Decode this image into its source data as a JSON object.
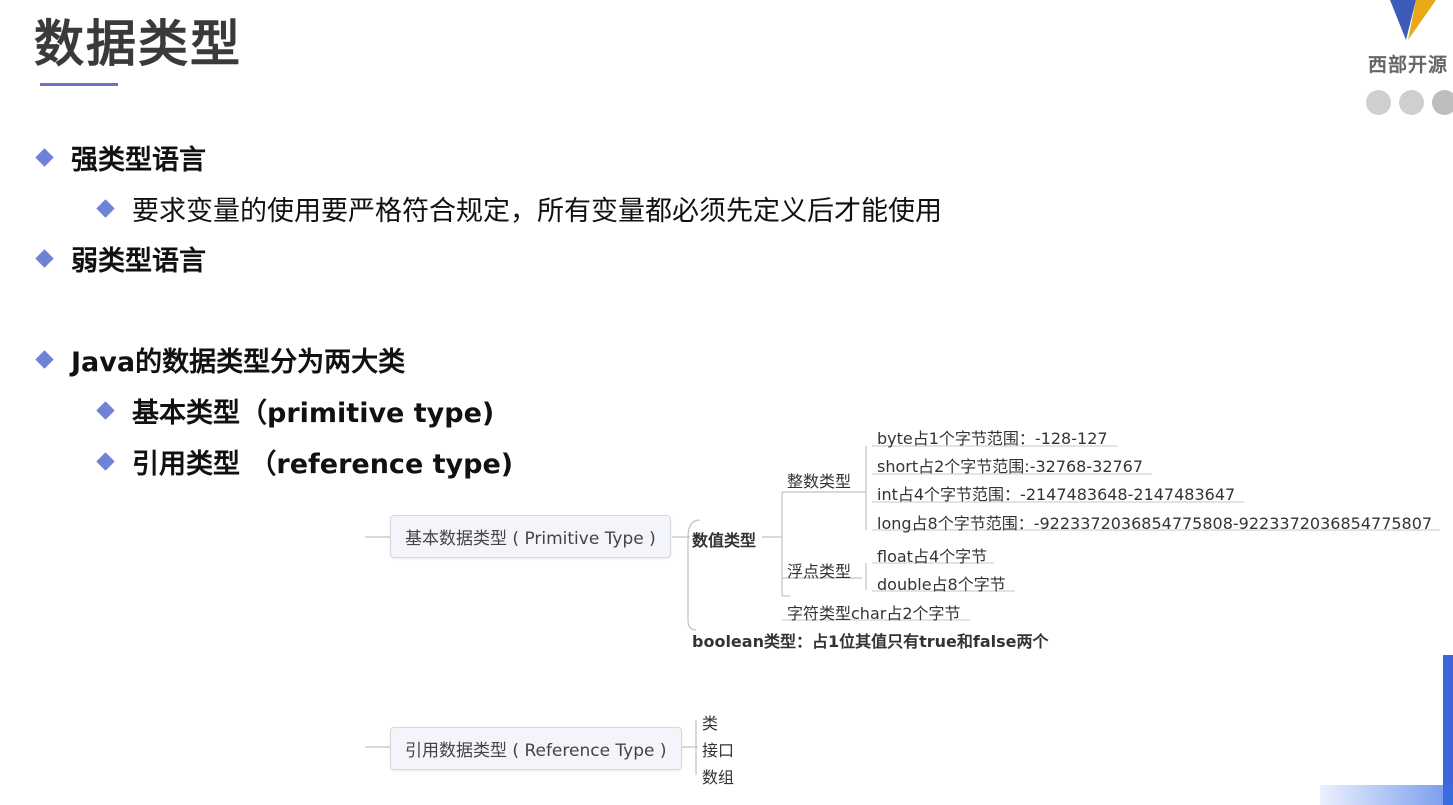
{
  "header": {
    "title": "数据类型",
    "logo_text": "西部开源",
    "accent_color": "#6b73c9"
  },
  "bullets": {
    "strong_typed": "强类型语言",
    "strong_typed_desc": "要求变量的使用要严格符合规定，所有变量都必须先定义后才能使用",
    "weak_typed": "弱类型语言",
    "java_types": "Java的数据类型分为两大类",
    "primitive": "基本类型（primitive type)",
    "reference": "引用类型 （reference type)"
  },
  "mindmap": {
    "primitive_root": "基本数据类型 ( Primitive Type )",
    "numeric": "数值类型",
    "integer": "整数类型",
    "byte": "byte占1个字节范围：-128-127",
    "short": "short占2个字节范围:-32768-32767",
    "int": "int占4个字节范围：-2147483648-2147483647",
    "long": "long占8个字节范围：-9223372036854775808-9223372036854775807",
    "floating": "浮点类型",
    "float": "float占4个字节",
    "double": "double占8个字节",
    "char": "字符类型char占2个字节",
    "boolean": "boolean类型：占1位其值只有true和false两个",
    "reference_root": "引用数据类型 ( Reference Type )",
    "class": "类",
    "interface": "接口",
    "array": "数组"
  }
}
